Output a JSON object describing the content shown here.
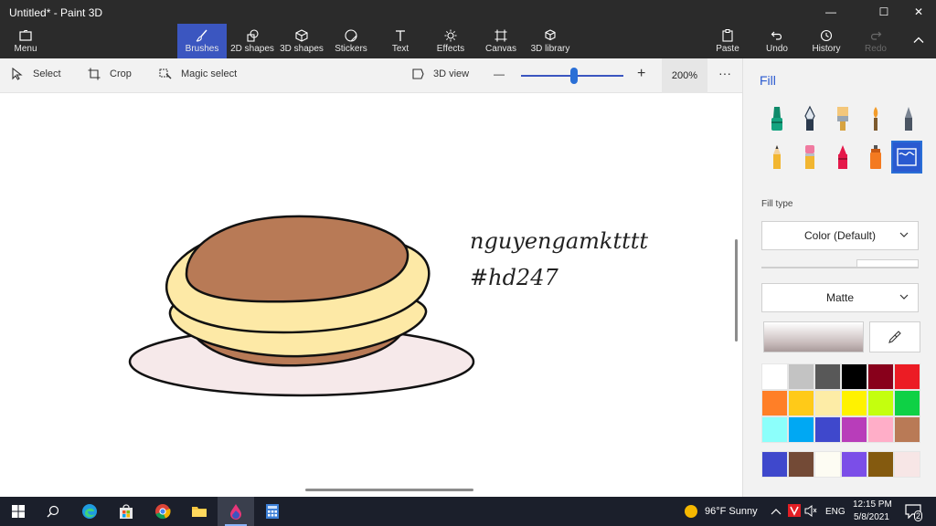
{
  "window": {
    "title": "Untitled* - Paint 3D",
    "minimize": "—",
    "maximize": "☐",
    "close": "✕"
  },
  "ribbon": {
    "menu": "Menu",
    "tabs": [
      "Brushes",
      "2D shapes",
      "3D shapes",
      "Stickers",
      "Text",
      "Effects",
      "Canvas",
      "3D library"
    ],
    "active_tab": "Brushes",
    "paste": "Paste",
    "undo": "Undo",
    "history": "History",
    "redo": "Redo"
  },
  "toolbar": {
    "select": "Select",
    "crop": "Crop",
    "magic_select": "Magic select",
    "view_3d": "3D view",
    "zoom_minus": "—",
    "zoom_plus": "+",
    "zoom": "200%",
    "zoom_level": 0.52,
    "more": "···"
  },
  "canvas": {
    "handwriting_line1": "nguyengamktttt",
    "handwriting_line2": "#hd247",
    "colors": {
      "plate": "#f6e9ea",
      "pancake": "#fde9a6",
      "top": "#b87a56",
      "outline": "#111111"
    }
  },
  "panel": {
    "title": "Fill",
    "brushes": [
      "marker-icon",
      "calligraphy-pen-icon",
      "oil-brush-icon",
      "watercolor-icon",
      "pixel-pen-icon",
      "pencil-icon",
      "eraser-icon",
      "crayon-icon",
      "spray-can-icon",
      "fill-icon"
    ],
    "selected_brush": "fill-icon",
    "fill_type_label": "Fill type",
    "fill_type_value": "Color (Default)",
    "finish_value": "Matte",
    "palette": [
      "#ffffff",
      "#c3c3c3",
      "#585858",
      "#000000",
      "#88001b",
      "#ec1c24",
      "#ff7f27",
      "#ffca18",
      "#fdeca6",
      "#fff200",
      "#c4ff0e",
      "#0ed145",
      "#8cfffb",
      "#00a8f3",
      "#3f48cc",
      "#b83dba",
      "#ffaec8",
      "#b97a56"
    ],
    "custom_colors": [
      "#3f48cc",
      "#734a36",
      "#fdfcf3",
      "#7b4ee8",
      "#845a0f",
      "#f7e6e6"
    ]
  },
  "taskbar": {
    "apps": [
      "windows-start-icon",
      "search-icon",
      "edge-icon",
      "store-icon",
      "chrome-icon",
      "file-explorer-icon",
      "paint3d-icon",
      "calculator-icon"
    ],
    "weather": "96°F  Sunny",
    "lang": "ENG",
    "time": "12:15 PM",
    "date": "5/8/2021",
    "notifications": "2"
  }
}
